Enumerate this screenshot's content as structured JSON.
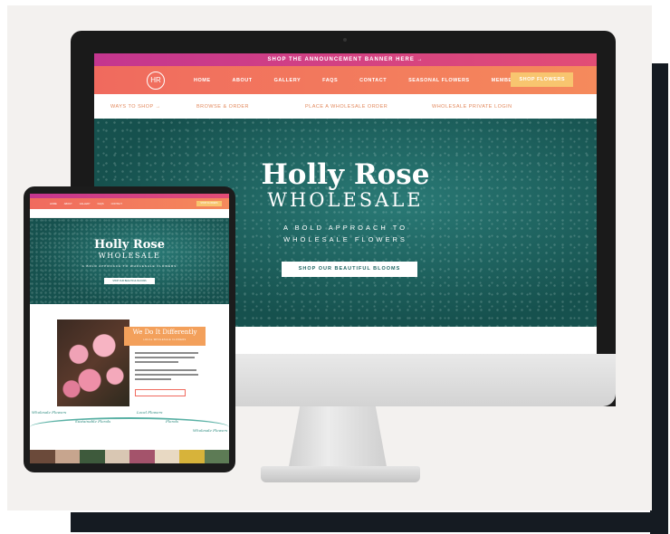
{
  "site": {
    "announcement": "SHOP THE ANNOUNCEMENT BANNER HERE →",
    "logo": "HR",
    "nav": [
      "HOME",
      "ABOUT",
      "GALLERY",
      "FAQS",
      "CONTACT",
      "SEASONAL FLOWERS",
      "MEMBER'S AREA"
    ],
    "shop_button": "SHOP FLOWERS",
    "subnav": [
      "WAYS TO SHOP →",
      "BROWSE & ORDER",
      "PLACE A WHOLESALE ORDER",
      "WHOLESALE PRIVATE LOGIN"
    ],
    "hero": {
      "title": "Holly Rose",
      "subtitle": "WHOLESALE",
      "tagline_1": "A BOLD APPROACH TO",
      "tagline_2": "WHOLESALE FLOWERS",
      "cta": "SHOP OUR BEAUTIFUL BLOOMS"
    }
  },
  "tablet": {
    "title": "Holly Rose",
    "subtitle": "WHOLESALE",
    "tagline": "A BOLD APPROACH TO WHOLESALE FLOWERS",
    "cta": "SHOP OUR BEAUTIFUL BLOOMS",
    "section_title": "We Do It Differently",
    "section_subtitle": "LOCAL WHOLESALE FLOWERS",
    "wave_labels": [
      "Wholesale Flowers",
      "Sustainable Florals",
      "Local Flowers",
      "Florals",
      "Wholesale Flowers"
    ]
  },
  "colors": {
    "teal": "#1e6562",
    "coral": "#f06a5e",
    "magenta": "#c4368f",
    "peach": "#f8c56f",
    "frame": "#151b22"
  }
}
